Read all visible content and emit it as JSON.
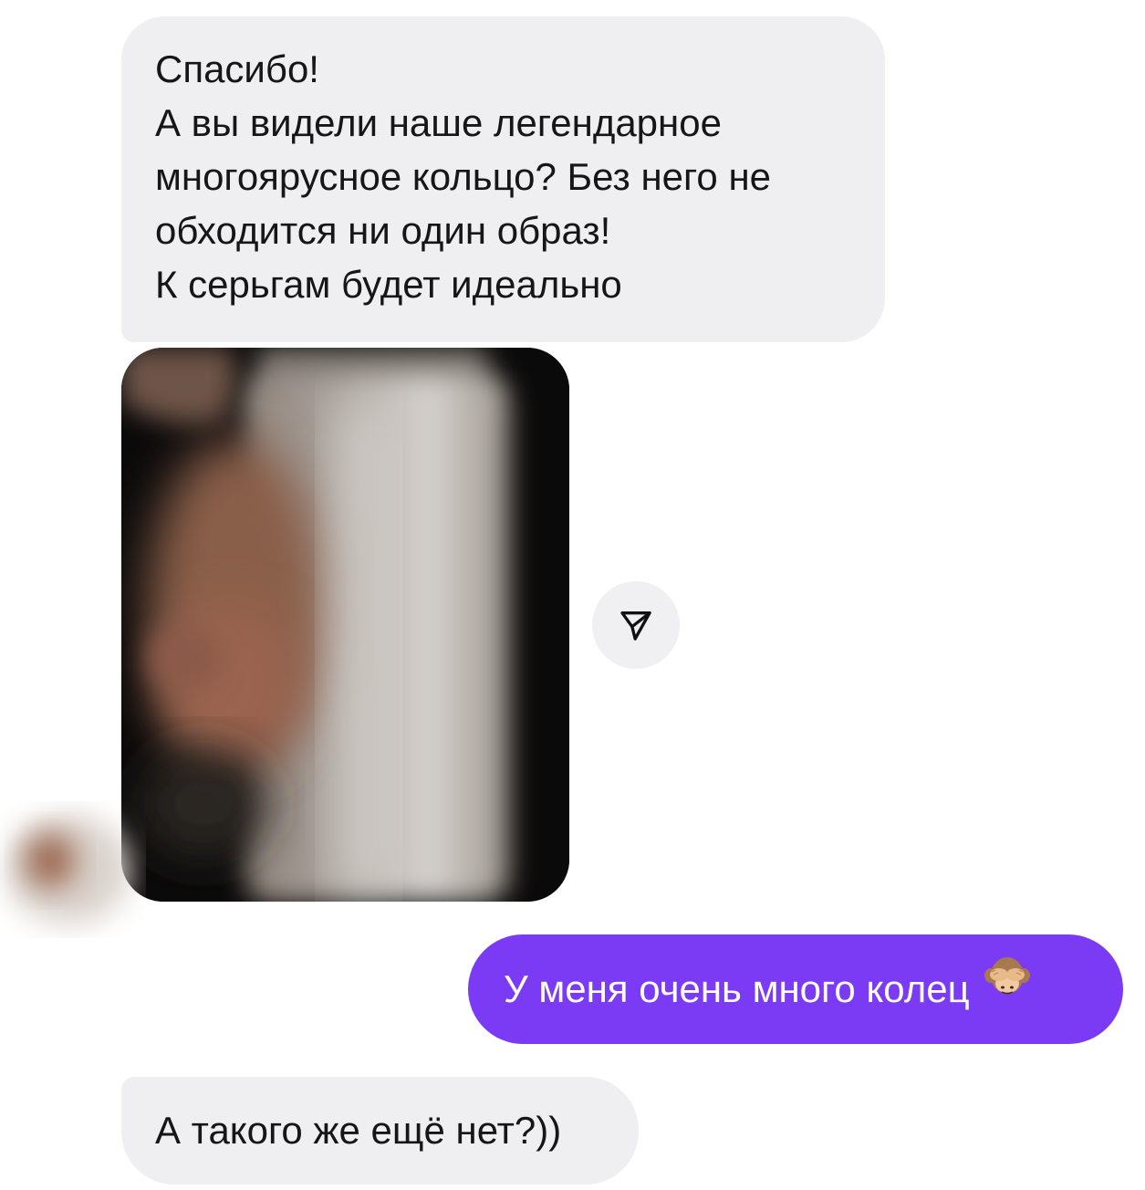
{
  "messages": {
    "incoming_1": {
      "lines": [
        "Спасибо!",
        "А вы видели наше легендарное",
        "многоярусное кольцо? Без него не",
        "обходится ни один образ!",
        "К серьгам будет идеально"
      ]
    },
    "outgoing_1": {
      "text": "У меня очень много колец",
      "emoji": "see-no-evil-monkey"
    },
    "incoming_2": {
      "text": "А такого же ещё нет?))"
    }
  },
  "icons": {
    "share": "paper-plane-icon"
  },
  "colors": {
    "incoming_bubble": "#efeff1",
    "outgoing_bubble": "#7b3bf5",
    "background": "#ffffff"
  }
}
